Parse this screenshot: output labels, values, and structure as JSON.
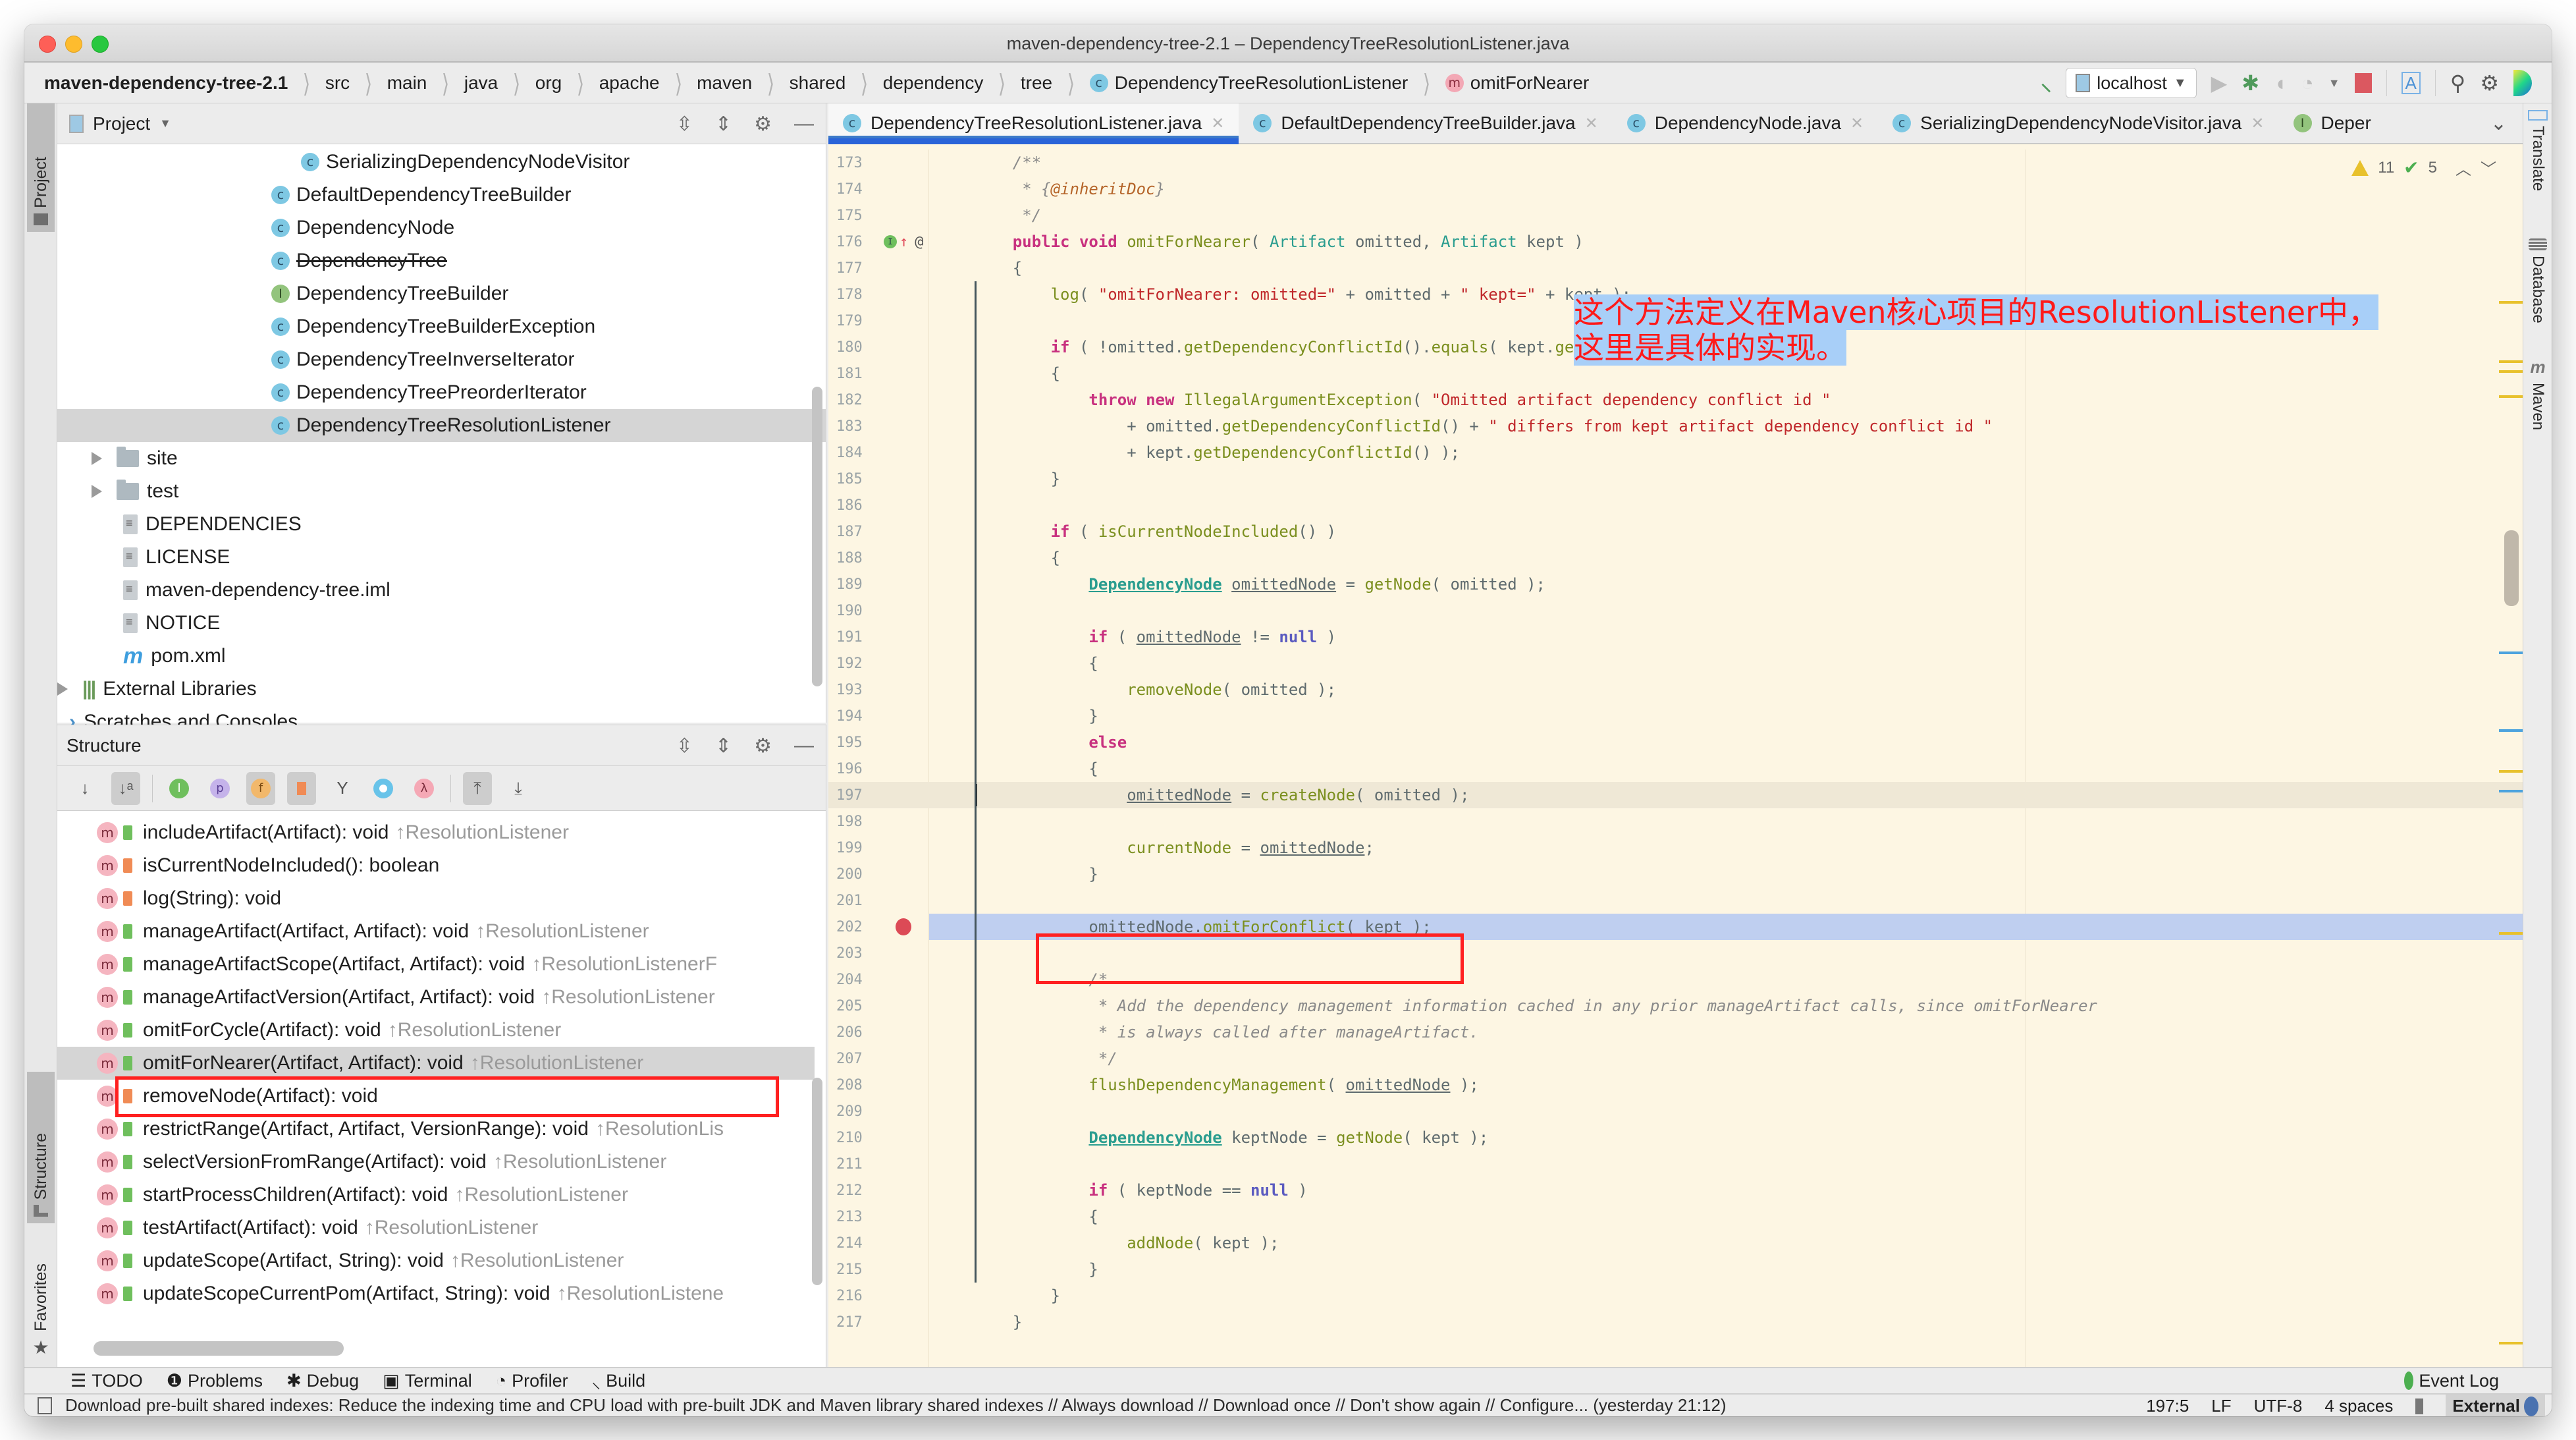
{
  "window": {
    "title": "maven-dependency-tree-2.1 – DependencyTreeResolutionListener.java"
  },
  "breadcrumb": [
    {
      "label": "maven-dependency-tree-2.1",
      "bold": true
    },
    {
      "label": "src"
    },
    {
      "label": "main"
    },
    {
      "label": "java"
    },
    {
      "label": "org"
    },
    {
      "label": "apache"
    },
    {
      "label": "maven"
    },
    {
      "label": "shared"
    },
    {
      "label": "dependency"
    },
    {
      "label": "tree"
    },
    {
      "label": "DependencyTreeResolutionListener",
      "icon": "class-icon"
    },
    {
      "label": "omitForNearer",
      "icon": "method-icon"
    }
  ],
  "toolbar": {
    "run_config": "localhost",
    "icons": [
      "build-hammer-icon",
      "run-icon",
      "debug-icon",
      "coverage-icon",
      "profile-icon",
      "stop-icon",
      "translate-icon",
      "search-icon",
      "settings-gear-icon",
      "jetbrains-toolbox-icon"
    ]
  },
  "left_strip": {
    "project_label": "Project",
    "structure_label": "Structure",
    "favorites_label": "Favorites"
  },
  "project_panel": {
    "title": "Project",
    "items": [
      {
        "label": "SerializingDependencyNodeVisitor",
        "type": "class",
        "indent": 4
      },
      {
        "label": "DefaultDependencyTreeBuilder",
        "type": "class",
        "indent": 3
      },
      {
        "label": "DependencyNode",
        "type": "class",
        "indent": 3
      },
      {
        "label": "DependencyTree",
        "type": "class",
        "indent": 3,
        "deprecated": true
      },
      {
        "label": "DependencyTreeBuilder",
        "type": "interface",
        "indent": 3
      },
      {
        "label": "DependencyTreeBuilderException",
        "type": "class",
        "indent": 3
      },
      {
        "label": "DependencyTreeInverseIterator",
        "type": "class",
        "indent": 3
      },
      {
        "label": "DependencyTreePreorderIterator",
        "type": "class",
        "indent": 3
      },
      {
        "label": "DependencyTreeResolutionListener",
        "type": "class",
        "indent": 3,
        "selected": true
      },
      {
        "label": "site",
        "type": "folder",
        "indent": 1,
        "collapsed": true
      },
      {
        "label": "test",
        "type": "folder",
        "indent": 1,
        "collapsed": true
      },
      {
        "label": "DEPENDENCIES",
        "type": "file",
        "indent": 1
      },
      {
        "label": "LICENSE",
        "type": "file",
        "indent": 1
      },
      {
        "label": "maven-dependency-tree.iml",
        "type": "iml",
        "indent": 1
      },
      {
        "label": "NOTICE",
        "type": "file",
        "indent": 1
      },
      {
        "label": "pom.xml",
        "type": "maven",
        "indent": 1
      },
      {
        "label": "External Libraries",
        "type": "libraries",
        "indent": 0,
        "collapsed": true
      },
      {
        "label": "Scratches and Consoles",
        "type": "scratches",
        "indent": 0
      }
    ]
  },
  "structure_panel": {
    "title": "Structure",
    "items": [
      {
        "signature": "includeArtifact(Artifact): void",
        "inherited": "↑ResolutionListener",
        "access": "public"
      },
      {
        "signature": "isCurrentNodeIncluded(): boolean",
        "inherited": "",
        "access": "private"
      },
      {
        "signature": "log(String): void",
        "inherited": "",
        "access": "private"
      },
      {
        "signature": "manageArtifact(Artifact, Artifact): void",
        "inherited": "↑ResolutionListener",
        "access": "public"
      },
      {
        "signature": "manageArtifactScope(Artifact, Artifact): void",
        "inherited": "↑ResolutionListenerF",
        "access": "public"
      },
      {
        "signature": "manageArtifactVersion(Artifact, Artifact): void",
        "inherited": "↑ResolutionListener",
        "access": "public"
      },
      {
        "signature": "omitForCycle(Artifact): void",
        "inherited": "↑ResolutionListener",
        "access": "public"
      },
      {
        "signature": "omitForNearer(Artifact, Artifact): void",
        "inherited": "↑ResolutionListener",
        "access": "public",
        "selected": true
      },
      {
        "signature": "removeNode(Artifact): void",
        "inherited": "",
        "access": "private"
      },
      {
        "signature": "restrictRange(Artifact, Artifact, VersionRange): void",
        "inherited": "↑ResolutionLis",
        "access": "public"
      },
      {
        "signature": "selectVersionFromRange(Artifact): void",
        "inherited": "↑ResolutionListener",
        "access": "public"
      },
      {
        "signature": "startProcessChildren(Artifact): void",
        "inherited": "↑ResolutionListener",
        "access": "public"
      },
      {
        "signature": "testArtifact(Artifact): void",
        "inherited": "↑ResolutionListener",
        "access": "public"
      },
      {
        "signature": "updateScope(Artifact, String): void",
        "inherited": "↑ResolutionListener",
        "access": "public"
      },
      {
        "signature": "updateScopeCurrentPom(Artifact, String): void",
        "inherited": "↑ResolutionListene",
        "access": "public"
      }
    ]
  },
  "tabs": [
    {
      "label": "DependencyTreeResolutionListener.java",
      "icon": "C",
      "active": true
    },
    {
      "label": "DefaultDependencyTreeBuilder.java",
      "icon": "C"
    },
    {
      "label": "DependencyNode.java",
      "icon": "C"
    },
    {
      "label": "SerializingDependencyNodeVisitor.java",
      "icon": "C"
    },
    {
      "label": "Deper",
      "icon": "I",
      "truncated": true
    }
  ],
  "inspections": {
    "warnings": "11",
    "weak_warnings": "5"
  },
  "annotation": {
    "line1": "这个方法定义在Maven核心项目的ResolutionListener中，",
    "line2": "这里是具体的实现。"
  },
  "code": {
    "first_line": 173,
    "caret_line": 197,
    "highlight_line": 202,
    "lines": [
      "    /**",
      "     * {@inheritDoc}",
      "     */",
      "    public void omitForNearer( Artifact omitted, Artifact kept )",
      "    {",
      "        log( \"omitForNearer: omitted=\" + omitted + \" kept=\" + kept );",
      "",
      "        if ( !omitted.getDependencyConflictId().equals( kept.getDependencyConflictId() ) )",
      "        {",
      "            throw new IllegalArgumentException( \"Omitted artifact dependency conflict id \"",
      "                + omitted.getDependencyConflictId() + \" differs from kept artifact dependency conflict id \"",
      "                + kept.getDependencyConflictId() );",
      "        }",
      "",
      "        if ( isCurrentNodeIncluded() )",
      "        {",
      "            DependencyNode omittedNode = getNode( omitted );",
      "",
      "            if ( omittedNode != null )",
      "            {",
      "                removeNode( omitted );",
      "            }",
      "            else",
      "            {",
      "                omittedNode = createNode( omitted );",
      "",
      "                currentNode = omittedNode;",
      "            }",
      "",
      "            omittedNode.omitForConflict( kept );",
      "",
      "            /*",
      "             * Add the dependency management information cached in any prior manageArtifact calls, since omitForNearer",
      "             * is always called after manageArtifact.",
      "             */",
      "            flushDependencyManagement( omittedNode );",
      "",
      "            DependencyNode keptNode = getNode( kept );",
      "",
      "            if ( keptNode == null )",
      "            {",
      "                addNode( kept );",
      "            }",
      "        }",
      "    }"
    ]
  },
  "right_strip": {
    "tabs": [
      "Translate",
      "Database",
      "Maven"
    ]
  },
  "bottom_toolwindows": [
    {
      "label": "TODO",
      "icon": "list-icon"
    },
    {
      "label": "Problems",
      "icon": "problems-icon"
    },
    {
      "label": "Debug",
      "icon": "bug-icon"
    },
    {
      "label": "Terminal",
      "icon": "terminal-icon"
    },
    {
      "label": "Profiler",
      "icon": "profiler-icon"
    },
    {
      "label": "Build",
      "icon": "hammer-icon"
    }
  ],
  "event_log": "Event Log",
  "status": {
    "message": "Download pre-built shared indexes: Reduce the indexing time and CPU load with pre-built JDK and Maven library shared indexes // Always download // Download once // Don't show again // Configure... (yesterday 21:12)",
    "position": "197:5",
    "line_separator": "LF",
    "encoding": "UTF-8",
    "indent": "4 spaces",
    "branch": "External"
  },
  "colors": {
    "editor_bg": "#fdf6e3",
    "selection_line": "#bfcff0",
    "annotation_text": "#ff1a1a",
    "annotation_highlight": "#a8cff8",
    "red_box": "#ff2020",
    "active_tab_underline": "#2a64d8"
  }
}
